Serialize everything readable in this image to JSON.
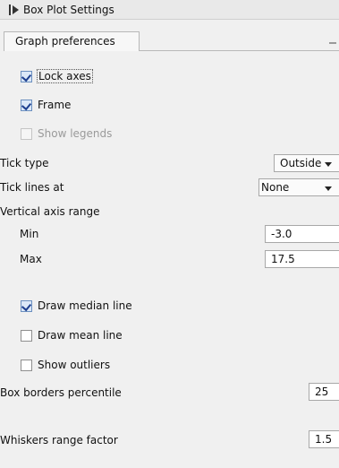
{
  "panel": {
    "title": "Box Plot Settings"
  },
  "tab": {
    "label": "Graph preferences"
  },
  "checks": {
    "lock_axes": {
      "label": "Lock axes",
      "checked": true
    },
    "frame": {
      "label": "Frame",
      "checked": true
    },
    "show_legends": {
      "label": "Show legends",
      "checked": false,
      "disabled": true
    },
    "draw_median": {
      "label": "Draw median line",
      "checked": true
    },
    "draw_mean": {
      "label": "Draw mean line",
      "checked": false
    },
    "show_outliers": {
      "label": "Show outliers",
      "checked": false
    }
  },
  "tick_type": {
    "label": "Tick type",
    "value": "Outside"
  },
  "tick_lines": {
    "label": "Tick lines at",
    "value": "None"
  },
  "vertical_axis": {
    "label": "Vertical axis range",
    "min_label": "Min",
    "min_value": "-3.0",
    "max_label": "Max",
    "max_value": "17.5"
  },
  "box_borders": {
    "label": "Box borders percentile",
    "value": "25"
  },
  "whiskers": {
    "label": "Whiskers range factor",
    "value": "1.5"
  }
}
